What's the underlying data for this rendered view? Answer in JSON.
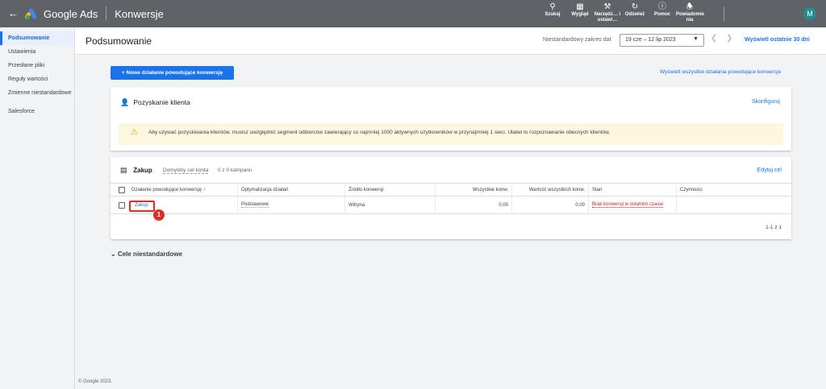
{
  "topbar": {
    "brand": "Google Ads",
    "section": "Konwersje",
    "avatar_letter": "M",
    "tools": [
      {
        "icon": "search-icon",
        "label": "Szukaj"
      },
      {
        "icon": "appearance-icon",
        "label": "Wygląd"
      },
      {
        "icon": "wrench-icon",
        "label": "Narzędz… i ustawi…"
      },
      {
        "icon": "refresh-icon",
        "label": "Odśwież"
      },
      {
        "icon": "help-icon",
        "label": "Pomoc"
      },
      {
        "icon": "bell-icon",
        "label": "Powiadomie nia"
      }
    ]
  },
  "sidebar": {
    "items": [
      {
        "label": "Podsumowanie",
        "active": true
      },
      {
        "label": "Ustawienia"
      },
      {
        "label": "Przesłane pliki"
      },
      {
        "label": "Reguły wartości"
      },
      {
        "label": "Zmienne niestandardowe"
      },
      {
        "label": "Salesforce"
      }
    ]
  },
  "header": {
    "title": "Podsumowanie",
    "range_label": "Niestandardowy zakres dat",
    "range_value": "19 cze – 12 lip 2023",
    "show_30": "Wyświetl ostatnie 30 dni"
  },
  "actions": {
    "new_button": "+ Nowe działanie powodujące konwersję",
    "view_all": "Wyświetl wszystkie działania powodujące konwersje"
  },
  "acquisition": {
    "title": "Pozyskanie klienta",
    "configure": "Skonfiguruj",
    "warning": "Aby używać pozyskiwania klientów, musisz uwzględnić segment odbiorców zawierający co najmniej 1000 aktywnych użytkowników w przynajmniej 1 sieci. Ułatwi to rozpoznawanie obecnych klientów."
  },
  "purchase": {
    "title": "Zakup",
    "default_goal": "Domyślny cel konta",
    "campaigns": "0 z 0 kampanii",
    "edit": "Edytuj cel",
    "columns": [
      "Działanie powodujące konwersję ↑",
      "Optymalizacja działań",
      "Źródło konwersji",
      "Wszystkie konw.",
      "Wartość wszystkich konw.",
      "Stan",
      "Czynności"
    ],
    "row": {
      "action": "Zakup",
      "optimization": "Podstawowe",
      "source": "Witryna",
      "all_conv": "0,00",
      "all_conv_value": "0,00",
      "status": "Brak konwersji w ostatnim czasie",
      "activities": ""
    },
    "pager": "1-1 z 1",
    "badge": "1"
  },
  "custom_goals": "Cele niestandardowe",
  "footer": "© Google 2023.",
  "colors": {
    "accent": "#1a73e8",
    "topbar": "#5f6368",
    "alert": "#d93025",
    "warning_bg": "#fef7e0"
  }
}
